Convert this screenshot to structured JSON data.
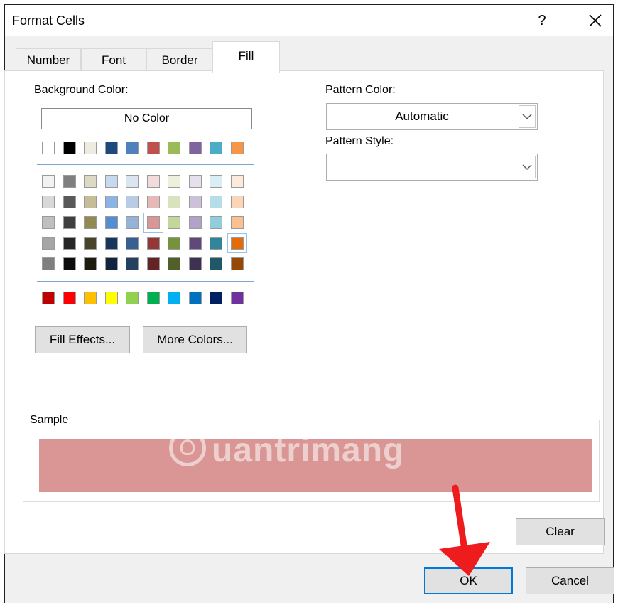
{
  "dialog": {
    "title": "Format Cells",
    "help": "?",
    "close": "✕"
  },
  "tabs": [
    {
      "label": "Number"
    },
    {
      "label": "Font"
    },
    {
      "label": "Border"
    },
    {
      "label": "Fill",
      "active": true
    }
  ],
  "fill": {
    "background_color_label": "Background Color:",
    "no_color_label": "No Color",
    "theme_row": [
      "#ffffff",
      "#000000",
      "#eeece1",
      "#1f497d",
      "#4f81bd",
      "#c0504d",
      "#9bbb59",
      "#8064a2",
      "#4bacc6",
      "#f79646"
    ],
    "shade_rows": [
      [
        "#f2f2f2",
        "#7f7f7f",
        "#ddd9c3",
        "#c6d9f0",
        "#dbe5f1",
        "#f2dcdb",
        "#ebf1dd",
        "#e5e0ec",
        "#dbeef3",
        "#fdeada"
      ],
      [
        "#d8d8d8",
        "#595959",
        "#c4bd97",
        "#8db3e2",
        "#b8cce4",
        "#e5b9b7",
        "#d7e3bc",
        "#ccc1d9",
        "#b7dde8",
        "#fbd5b5"
      ],
      [
        "#bfbfbf",
        "#3f3f3f",
        "#938953",
        "#548dd4",
        "#95b3d7",
        "#d99694",
        "#c3d69b",
        "#b2a2c7",
        "#92cddc",
        "#fac08f"
      ],
      [
        "#a5a5a5",
        "#262626",
        "#494429",
        "#17365d",
        "#366092",
        "#953734",
        "#76923c",
        "#5f497a",
        "#31859b",
        "#e36c09"
      ],
      [
        "#7f7f7f",
        "#0c0c0c",
        "#1d1b10",
        "#0f243e",
        "#244061",
        "#632423",
        "#4f6128",
        "#3f3151",
        "#205867",
        "#974806"
      ]
    ],
    "standard_row": [
      "#c00000",
      "#ff0000",
      "#ffc000",
      "#ffff00",
      "#92d050",
      "#00b050",
      "#00b0f0",
      "#0070c0",
      "#002060",
      "#7030a0"
    ],
    "selected_color": "#d99694",
    "fill_effects_label": "Fill Effects...",
    "more_colors_label": "More Colors...",
    "pattern_color_label": "Pattern Color:",
    "pattern_color_value": "Automatic",
    "pattern_style_label": "Pattern Style:",
    "pattern_style_value": ""
  },
  "sample": {
    "label": "Sample",
    "color": "#d99694",
    "watermark": "uantrimang"
  },
  "buttons": {
    "clear": "Clear",
    "ok": "OK",
    "cancel": "Cancel"
  }
}
